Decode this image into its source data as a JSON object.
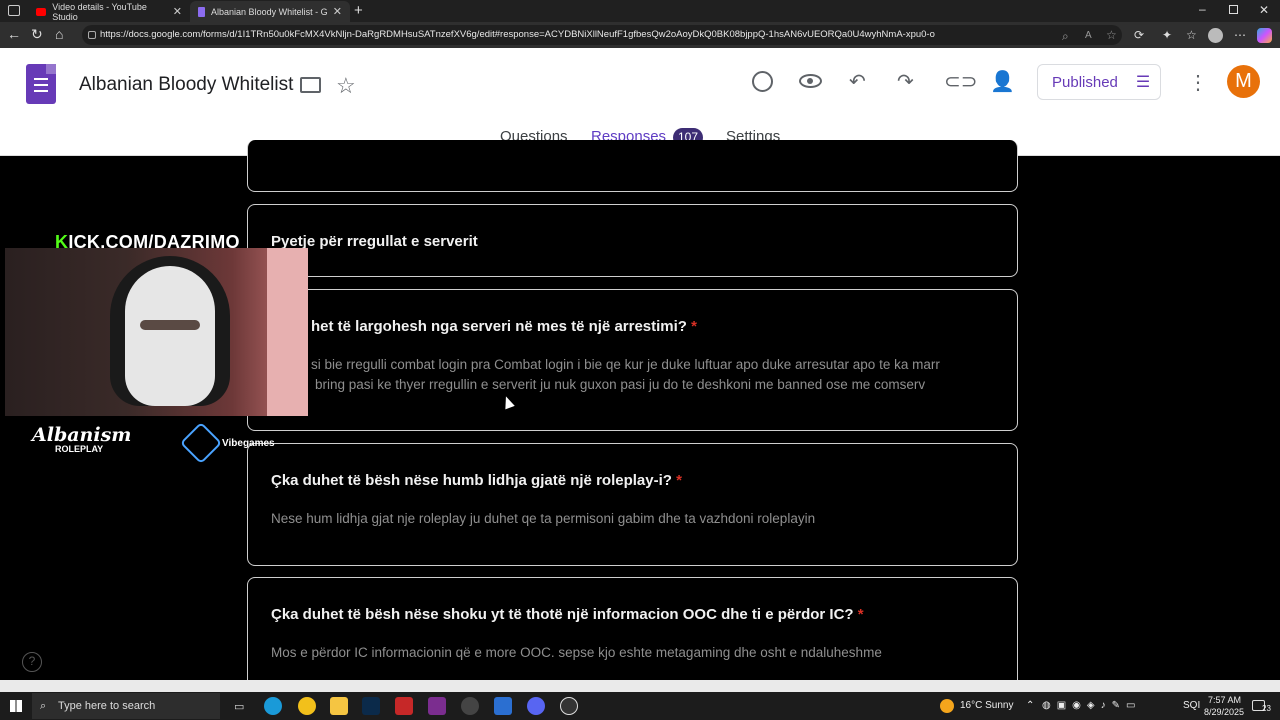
{
  "browser": {
    "tabs": [
      {
        "label": "Video details - YouTube Studio"
      },
      {
        "label": "Albanian Bloody Whitelist - Goog"
      }
    ],
    "url": "https://docs.google.com/forms/d/1I1TRn50u0kFcMX4VkNljn-DaRgRDMHsuSATnzefXV6g/edit#response=ACYDBNiXllNeufF1gfbesQw2oAoyDkQ0BK08bjppQ-1hsAN6vUEORQa0U4wyhNmA-xpu0-o"
  },
  "form": {
    "title": "Albanian Bloody Whitelist",
    "publish_label": "Published",
    "avatar_letter": "M",
    "tabs": {
      "questions": "Questions",
      "responses": "Responses",
      "responses_count": "107",
      "settings": "Settings"
    }
  },
  "cards": {
    "section_title": "Pyetje për rregullat e serverit",
    "q1": {
      "title": "het të largohesh nga serveri në mes të një arrestimi?",
      "required": "*",
      "answer_line1": "si bie rregulli combat login pra Combat login i bie qe kur je duke luftuar apo duke arresutar apo te ka marr",
      "answer_line2": "bring pasi ke thyer rregullin e serverit ju nuk guxon pasi ju do te deshkoni me banned ose me comserv"
    },
    "q2": {
      "title": "Çka duhet të bësh nëse humb lidhja gjatë një roleplay-i?",
      "required": "*",
      "answer": "Nese hum lidhja gjat nje roleplay ju duhet qe ta permisoni gabim dhe ta vazhdoni roleplayin"
    },
    "q3": {
      "title": "Çka duhet të bësh nëse shoku yt të thotë një informacion OOC dhe ti e përdor IC?",
      "required": "*",
      "answer": "Mos e përdor IC informacionin që e more OOC. sepse kjo eshte metagaming dhe osht e ndaluheshme"
    }
  },
  "overlay": {
    "kick_k": "K",
    "kick_rest": "ICK.COM/DAZRIMO",
    "logo_main": "Albanism",
    "logo_sub": "ROLEPLAY",
    "vibe": "Vibegames"
  },
  "taskbar": {
    "search_placeholder": "Type here to search",
    "weather": "16°C  Sunny",
    "lang": "SQI",
    "time": "7:57 AM",
    "date": "8/29/2025",
    "notif_count": "23"
  }
}
